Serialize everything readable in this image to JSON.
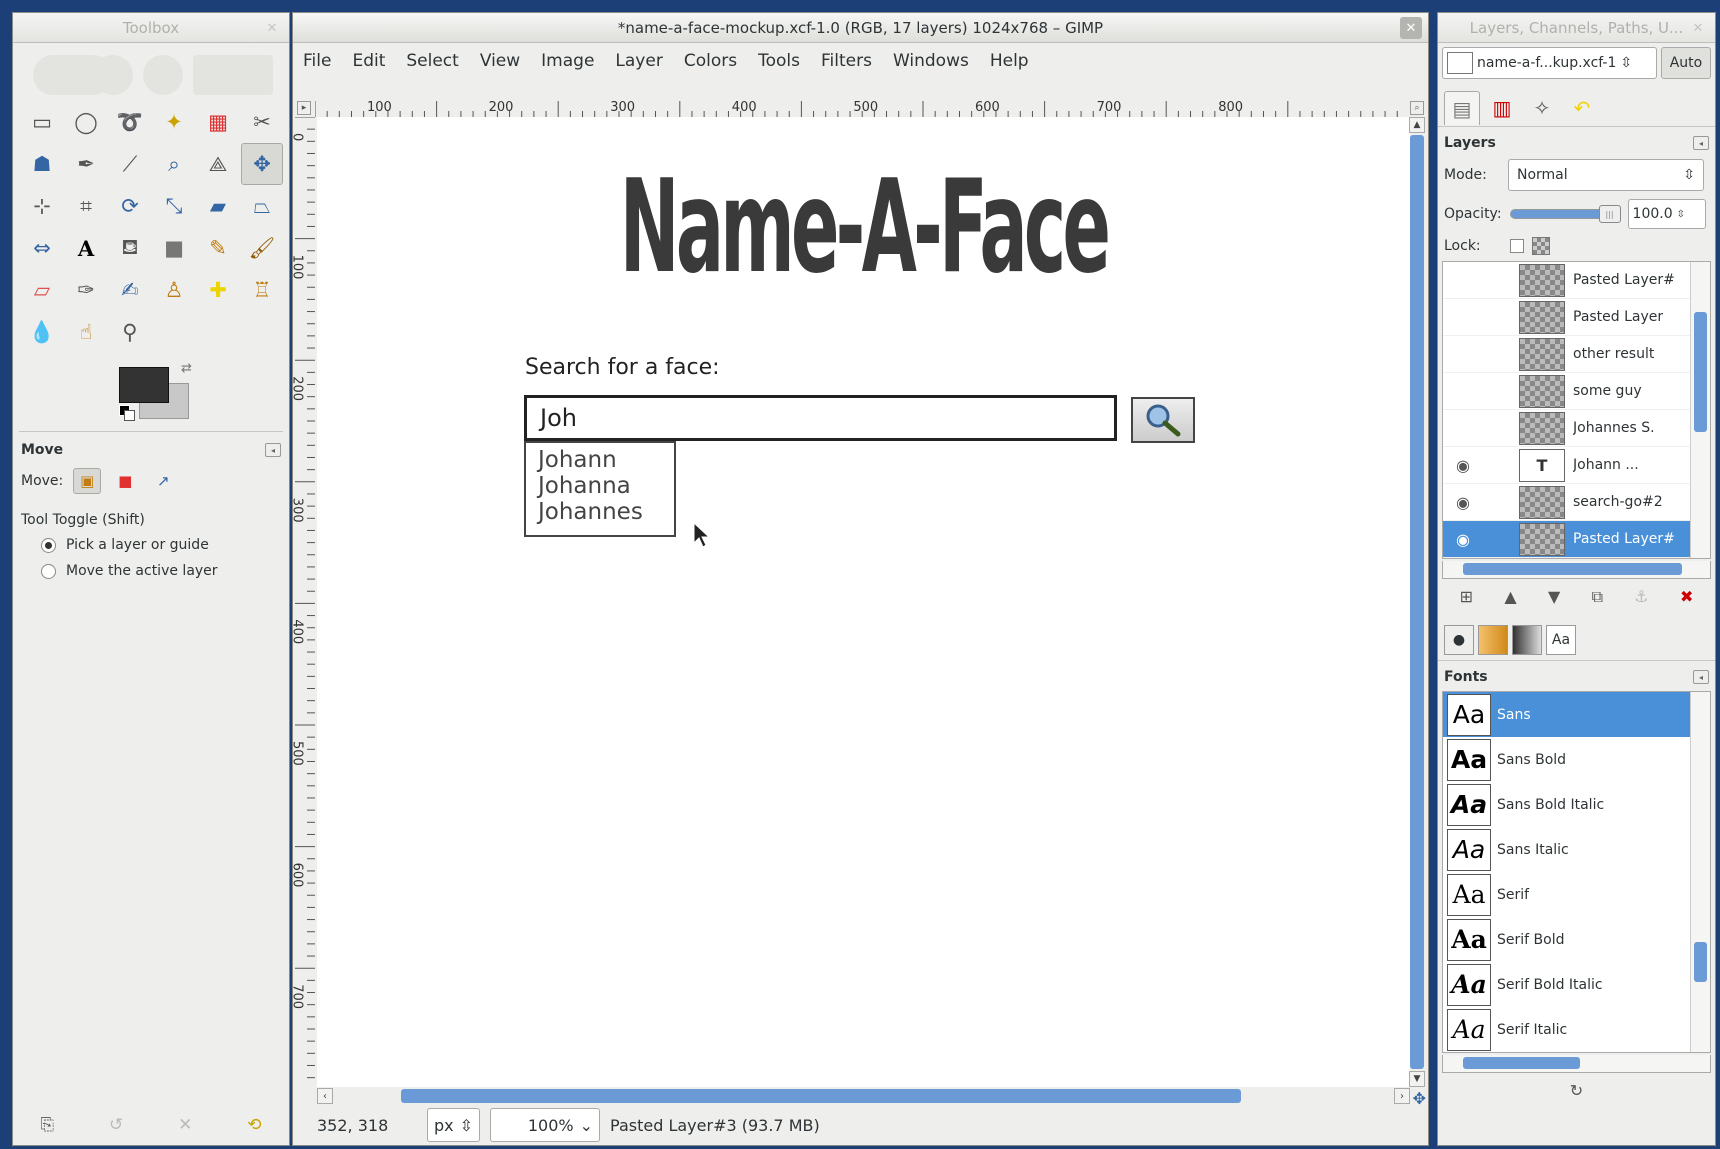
{
  "toolbox": {
    "title": "Toolbox",
    "tool_options_title": "Move",
    "move_label": "Move:",
    "tool_toggle_label": "Tool Toggle  (Shift)",
    "radio_pick": "Pick a layer or guide",
    "radio_move_active": "Move the active layer"
  },
  "main": {
    "title": "*name-a-face-mockup.xcf-1.0 (RGB, 17 layers) 1024x768 – GIMP",
    "menu": [
      "File",
      "Edit",
      "Select",
      "View",
      "Image",
      "Layer",
      "Colors",
      "Tools",
      "Filters",
      "Windows",
      "Help"
    ],
    "hruler_labels": [
      "100",
      "200",
      "300",
      "400",
      "500",
      "600",
      "700",
      "800"
    ],
    "vruler_labels": [
      "0",
      "100",
      "200",
      "300",
      "400",
      "500",
      "600",
      "700"
    ],
    "status": {
      "coords": "352, 318",
      "unit": "px",
      "zoom": "100%",
      "info": "Pasted Layer#3 (93.7 MB)"
    }
  },
  "mockup": {
    "app_title": "Name-A-Face",
    "search_label": "Search for a face:",
    "search_value": "Joh",
    "suggestions": [
      "Johann",
      "Johanna",
      "Johannes"
    ]
  },
  "dock": {
    "title": "Layers, Channels, Paths, U...",
    "image_combo": "name-a-f...kup.xcf-1",
    "auto_label": "Auto",
    "layers_title": "Layers",
    "mode_label": "Mode:",
    "mode_value": "Normal",
    "opacity_label": "Opacity:",
    "opacity_value": "100.0",
    "lock_label": "Lock:",
    "layers": [
      {
        "name": "Pasted Layer#",
        "visible": false
      },
      {
        "name": "Pasted Layer",
        "visible": false
      },
      {
        "name": "other result",
        "visible": false
      },
      {
        "name": "some guy",
        "visible": false
      },
      {
        "name": "Johannes S.",
        "visible": false
      },
      {
        "name": "Johann ...",
        "visible": true
      },
      {
        "name": "search-go#2",
        "visible": true
      },
      {
        "name": "Pasted Layer#",
        "visible": true
      }
    ],
    "fonts_title": "Fonts",
    "fonts": [
      "Sans",
      "Sans Bold",
      "Sans Bold Italic",
      "Sans Italic",
      "Serif",
      "Serif Bold",
      "Serif Bold Italic",
      "Serif Italic"
    ],
    "font_tab_label": "Aa",
    "font_preview": "Aa"
  },
  "colors": {
    "selection": "#4a90d9",
    "scrollbar": "#6b9bd6",
    "desktop": "#1c3f78"
  }
}
